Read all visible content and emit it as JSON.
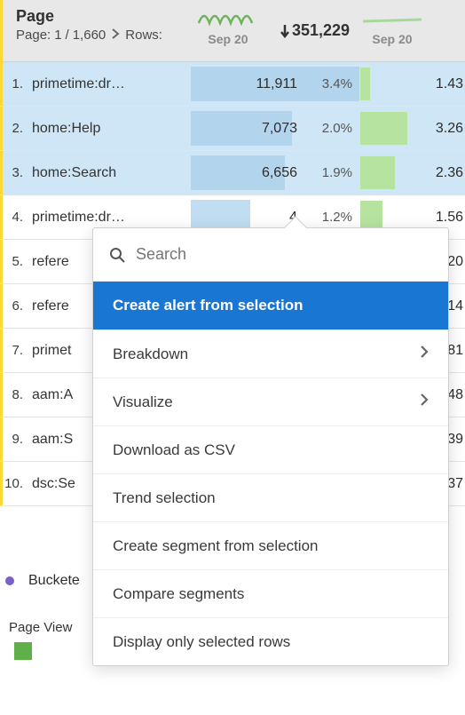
{
  "header": {
    "title": "Page",
    "page_label": "Page:",
    "page_current": "1",
    "page_sep": "/",
    "page_total": "1,660",
    "rows_label": "Rows:",
    "spark_date_1": "Sep 20",
    "spark_date_2": "Sep 20",
    "metric_change": "351,229"
  },
  "rows": [
    {
      "idx": "1.",
      "name": "primetime:dr…",
      "value": "11,911",
      "pct": "3.4%",
      "bar_pct": 20,
      "right": "1.43",
      "sel": true,
      "valbg": 100
    },
    {
      "idx": "2.",
      "name": "home:Help",
      "value": "7,073",
      "pct": "2.0%",
      "bar_pct": 95,
      "right": "3.26",
      "sel": true,
      "valbg": 60
    },
    {
      "idx": "3.",
      "name": "home:Search",
      "value": "6,656",
      "pct": "1.9%",
      "bar_pct": 70,
      "right": "2.36",
      "sel": true,
      "valbg": 56
    },
    {
      "idx": "4.",
      "name": "primetime:dr…",
      "value": "4",
      "pct": "1.2%",
      "bar_pct": 45,
      "right": "1.56",
      "sel": false,
      "valbg": 35
    },
    {
      "idx": "5.",
      "name": "refere",
      "value": "",
      "pct": "",
      "bar_pct": 0,
      "right": "20",
      "sel": false,
      "valbg": 0
    },
    {
      "idx": "6.",
      "name": "refere",
      "value": "",
      "pct": "",
      "bar_pct": 0,
      "right": "14",
      "sel": false,
      "valbg": 0
    },
    {
      "idx": "7.",
      "name": "primet",
      "value": "",
      "pct": "",
      "bar_pct": 0,
      "right": "81",
      "sel": false,
      "valbg": 0
    },
    {
      "idx": "8.",
      "name": "aam:A",
      "value": "",
      "pct": "",
      "bar_pct": 0,
      "right": "48",
      "sel": false,
      "valbg": 0
    },
    {
      "idx": "9.",
      "name": "aam:S",
      "value": "",
      "pct": "",
      "bar_pct": 0,
      "right": "39",
      "sel": false,
      "valbg": 0
    },
    {
      "idx": "10.",
      "name": "dsc:Se",
      "value": "",
      "pct": "",
      "bar_pct": 0,
      "right": "37",
      "sel": false,
      "valbg": 0
    }
  ],
  "popup": {
    "search_placeholder": "Search",
    "items": [
      {
        "label": "Create alert from selection",
        "hl": true,
        "submenu": false
      },
      {
        "label": "Breakdown",
        "hl": false,
        "submenu": true
      },
      {
        "label": "Visualize",
        "hl": false,
        "submenu": true
      },
      {
        "label": "Download as CSV",
        "hl": false,
        "submenu": false
      },
      {
        "label": "Trend selection",
        "hl": false,
        "submenu": false
      },
      {
        "label": "Create segment from selection",
        "hl": false,
        "submenu": false
      },
      {
        "label": "Compare segments",
        "hl": false,
        "submenu": false
      },
      {
        "label": "Display only selected rows",
        "hl": false,
        "submenu": false
      }
    ]
  },
  "footer": {
    "bucket_label": "Buckete",
    "pv_label": "Page View"
  }
}
